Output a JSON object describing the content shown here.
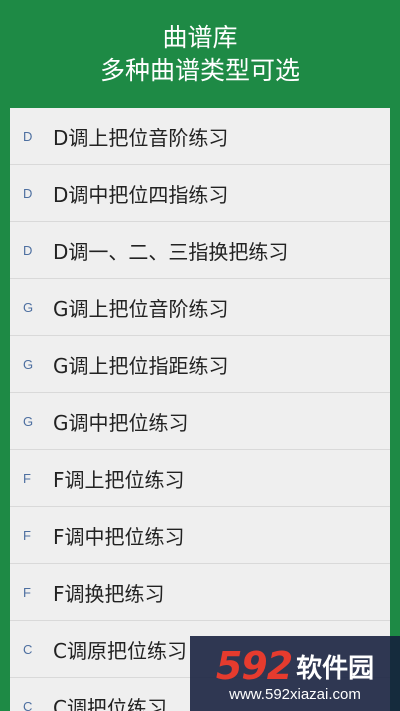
{
  "header": {
    "title": "曲谱库",
    "subtitle": "多种曲谱类型可选"
  },
  "list": {
    "items": [
      {
        "key": "D",
        "title": "D调上把位音阶练习"
      },
      {
        "key": "D",
        "title": "D调中把位四指练习"
      },
      {
        "key": "D",
        "title": "D调一、二、三指换把练习"
      },
      {
        "key": "G",
        "title": "G调上把位音阶练习"
      },
      {
        "key": "G",
        "title": "G调上把位指距练习"
      },
      {
        "key": "G",
        "title": "G调中把位练习"
      },
      {
        "key": "F",
        "title": "F调上把位练习"
      },
      {
        "key": "F",
        "title": "F调中把位练习"
      },
      {
        "key": "F",
        "title": "F调换把练习"
      },
      {
        "key": "C",
        "title": "C调原把位练习"
      },
      {
        "key": "C",
        "title": "C调把位练习"
      }
    ]
  },
  "watermark": {
    "number": "592",
    "text": "软件园",
    "url": "www.592xiazai.com"
  },
  "colors": {
    "header_bg": "#1e8a45",
    "list_bg": "#efefef",
    "key_text": "#4d6fa0",
    "watermark_number": "#e63b2e"
  }
}
